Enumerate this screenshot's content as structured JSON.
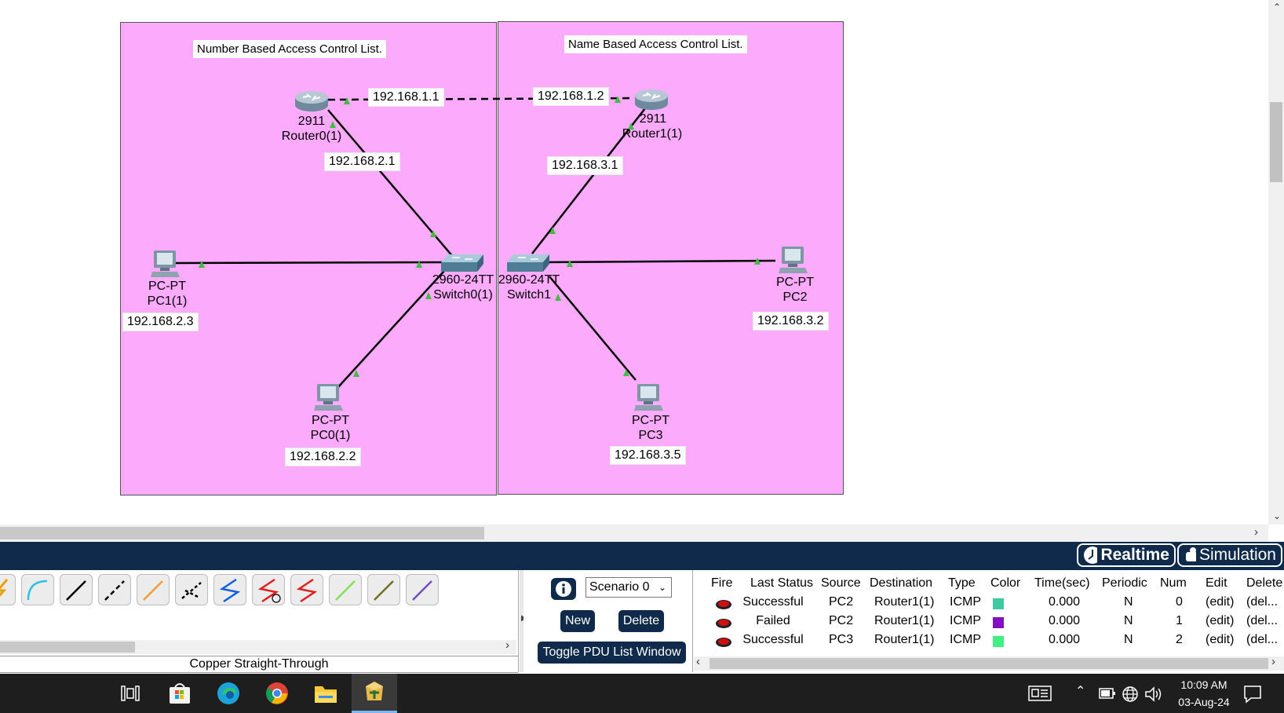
{
  "workspace": {
    "notes": {
      "left": "Number Based Access Control List.",
      "right": "Name Based Access Control List."
    },
    "devices": {
      "router0": {
        "model": "2911",
        "name": "Router0(1)"
      },
      "router1": {
        "model": "2911",
        "name": "Router1(1)"
      },
      "switch0": {
        "model": "2960-24TT",
        "name": "Switch0(1)"
      },
      "switch1": {
        "model": "2960-24TT",
        "name": "Switch1"
      },
      "pc1": {
        "model": "PC-PT",
        "name": "PC1(1)",
        "ip": "192.168.2.3"
      },
      "pc0": {
        "model": "PC-PT",
        "name": "PC0(1)",
        "ip": "192.168.2.2"
      },
      "pc2": {
        "model": "PC-PT",
        "name": "PC2",
        "ip": "192.168.3.2"
      },
      "pc3": {
        "model": "PC-PT",
        "name": "PC3",
        "ip": "192.168.3.5"
      }
    },
    "links": {
      "r0_r1_a": "192.168.1.1",
      "r0_r1_b": "192.168.1.2",
      "r0_sw0": "192.168.2.1",
      "r1_sw1": "192.168.3.1"
    }
  },
  "modebar": {
    "realtime": "Realtime",
    "simulation": "Simulation"
  },
  "connections": {
    "selected_label": "Copper Straight-Through",
    "tools": [
      {
        "icon": "automatic-connection-icon",
        "color": "#e8a000"
      },
      {
        "icon": "console-cable-icon",
        "color": "#30c0e0"
      },
      {
        "icon": "copper-straight-through-icon",
        "color": "#000000"
      },
      {
        "icon": "copper-cross-over-icon",
        "color": "#000000"
      },
      {
        "icon": "fiber-icon",
        "color": "#f0a030"
      },
      {
        "icon": "phone-cable-icon",
        "color": "#000000"
      },
      {
        "icon": "coaxial-icon",
        "color": "#1060e0"
      },
      {
        "icon": "serial-dce-icon",
        "color": "#e02020"
      },
      {
        "icon": "serial-dte-icon",
        "color": "#e02020"
      },
      {
        "icon": "octal-cable-icon",
        "color": "#80e060"
      },
      {
        "icon": "iot-custom-cable-icon",
        "color": "#707020"
      },
      {
        "icon": "usb-cable-icon",
        "color": "#7050c0"
      }
    ]
  },
  "pdu": {
    "scenario": "Scenario 0",
    "new_label": "New",
    "delete_label": "Delete",
    "toggle_label": "Toggle PDU List Window",
    "headers": [
      "Fire",
      "Last Status",
      "Source",
      "Destination",
      "Type",
      "Color",
      "Time(sec)",
      "Periodic",
      "Num",
      "Edit",
      "Delete"
    ],
    "rows": [
      {
        "status": "Successful",
        "source": "PC2",
        "destination": "Router1(1)",
        "type": "ICMP",
        "color": "#40c8a0",
        "time": "0.000",
        "periodic": "N",
        "num": "0",
        "edit": "(edit)",
        "delete": "(del..."
      },
      {
        "status": "Failed",
        "source": "PC2",
        "destination": "Router1(1)",
        "type": "ICMP",
        "color": "#8010c0",
        "time": "0.000",
        "periodic": "N",
        "num": "1",
        "edit": "(edit)",
        "delete": "(del..."
      },
      {
        "status": "Successful",
        "source": "PC3",
        "destination": "Router1(1)",
        "type": "ICMP",
        "color": "#40f080",
        "time": "0.000",
        "periodic": "N",
        "num": "2",
        "edit": "(edit)",
        "delete": "(del..."
      }
    ]
  },
  "taskbar": {
    "time": "10:09 AM",
    "date": "03-Aug-24"
  }
}
